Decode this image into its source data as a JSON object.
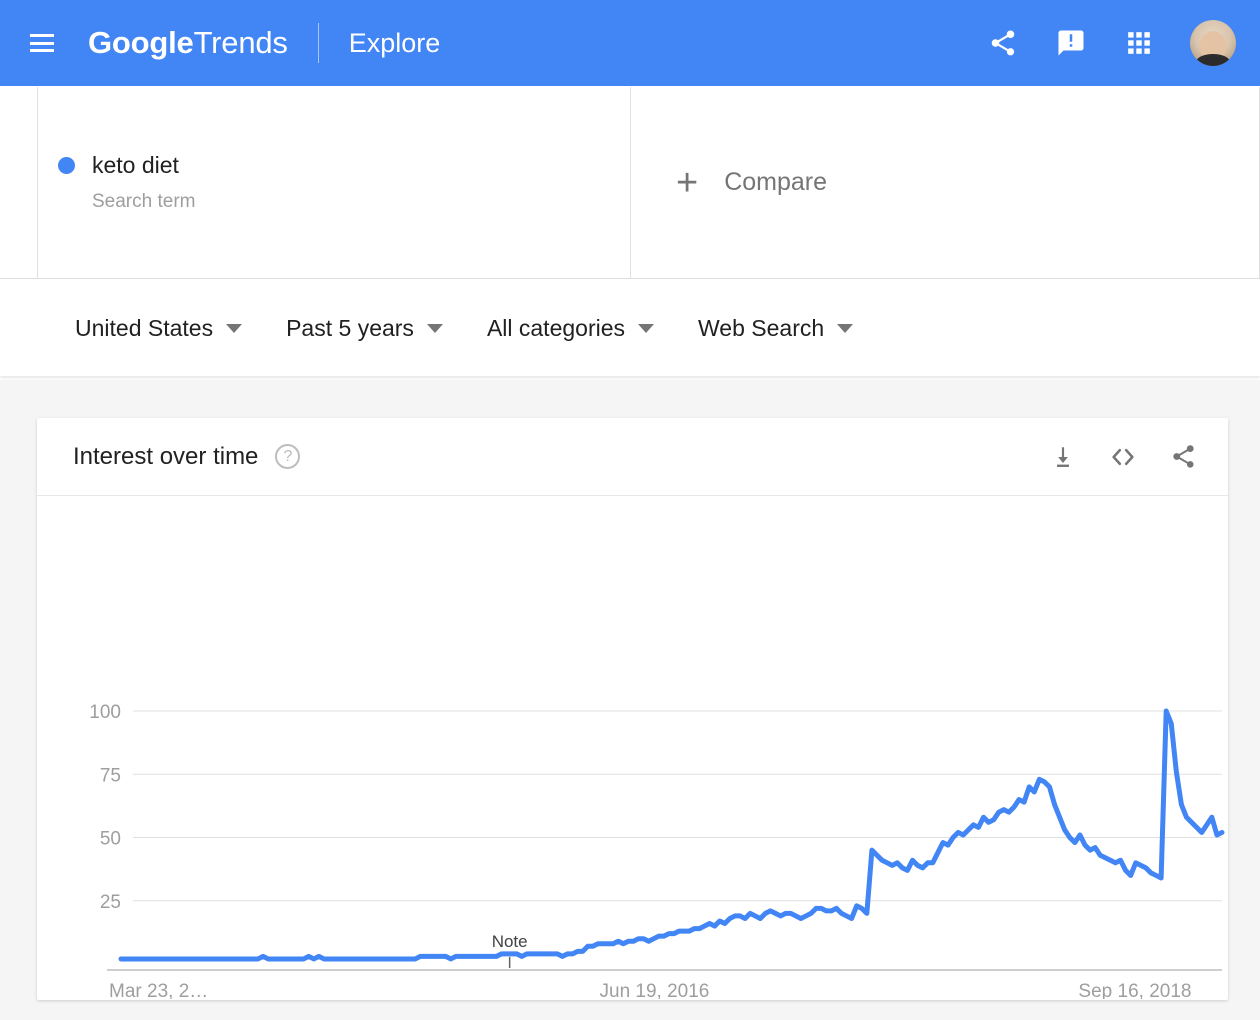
{
  "header": {
    "menu_icon": "hamburger-icon",
    "brand_primary": "Google",
    "brand_secondary": "Trends",
    "section": "Explore",
    "share_icon": "share-icon",
    "feedback_icon": "feedback-icon",
    "apps_icon": "apps-grid-icon",
    "avatar_icon": "user-avatar",
    "background_color": "#4285F4"
  },
  "terms": {
    "search_term": {
      "name": "keto diet",
      "type_label": "Search term",
      "color": "#4285F4"
    },
    "compare": {
      "plus": "+",
      "label": "Compare"
    }
  },
  "filters": [
    {
      "label": "United States"
    },
    {
      "label": "Past 5 years"
    },
    {
      "label": "All categories"
    },
    {
      "label": "Web Search"
    }
  ],
  "chart_card": {
    "title": "Interest over time",
    "help_icon": "help-circle-icon",
    "download_icon": "download-icon",
    "embed_icon": "embed-code-icon",
    "share_icon": "share-icon"
  },
  "chart_data": {
    "type": "line",
    "title": "Interest over time",
    "xlabel": "",
    "ylabel": "",
    "ylim": [
      0,
      100
    ],
    "yticks": [
      25,
      50,
      75,
      100
    ],
    "ytick_labels": [
      "25",
      "50",
      "75",
      "100"
    ],
    "xtick_labels": [
      "Mar 23, 2…",
      "Jun 19, 2016",
      "Sep 16, 2018"
    ],
    "xtick_positions": [
      0,
      0.5,
      0.935
    ],
    "grid": true,
    "legend": false,
    "line_color": "#4285F4",
    "line_width": 5,
    "annotations": [
      {
        "text": "Note",
        "x_frac": 0.353,
        "value": 2
      }
    ],
    "series": [
      {
        "name": "keto diet",
        "color": "#4285F4",
        "values": [
          2,
          2,
          2,
          2,
          2,
          2,
          2,
          2,
          2,
          2,
          2,
          2,
          2,
          2,
          2,
          2,
          2,
          2,
          2,
          2,
          2,
          2,
          2,
          2,
          2,
          2,
          2,
          2,
          3,
          2,
          2,
          2,
          2,
          2,
          2,
          2,
          2,
          3,
          2,
          3,
          2,
          2,
          2,
          2,
          2,
          2,
          2,
          2,
          2,
          2,
          2,
          2,
          2,
          2,
          2,
          2,
          2,
          2,
          2,
          3,
          3,
          3,
          3,
          3,
          3,
          2,
          3,
          3,
          3,
          3,
          3,
          3,
          3,
          3,
          3,
          4,
          4,
          4,
          4,
          3,
          4,
          4,
          4,
          4,
          4,
          4,
          4,
          3,
          4,
          4,
          5,
          5,
          7,
          7,
          8,
          8,
          8,
          8,
          9,
          8,
          9,
          9,
          10,
          10,
          9,
          10,
          11,
          11,
          12,
          12,
          13,
          13,
          13,
          14,
          14,
          15,
          16,
          15,
          17,
          16,
          18,
          19,
          19,
          18,
          20,
          19,
          18,
          20,
          21,
          20,
          19,
          20,
          20,
          19,
          18,
          19,
          20,
          22,
          22,
          21,
          21,
          22,
          20,
          19,
          18,
          23,
          22,
          20,
          45,
          43,
          41,
          40,
          39,
          40,
          38,
          37,
          41,
          39,
          38,
          40,
          40,
          44,
          48,
          47,
          50,
          52,
          51,
          53,
          55,
          54,
          58,
          56,
          57,
          60,
          61,
          60,
          62,
          65,
          64,
          70,
          68,
          73,
          72,
          70,
          63,
          58,
          53,
          50,
          48,
          51,
          47,
          45,
          46,
          43,
          42,
          41,
          40,
          41,
          37,
          35,
          40,
          39,
          38,
          36,
          35,
          34,
          100,
          95,
          76,
          63,
          58,
          56,
          54,
          52,
          55,
          58,
          51,
          52
        ]
      }
    ]
  }
}
